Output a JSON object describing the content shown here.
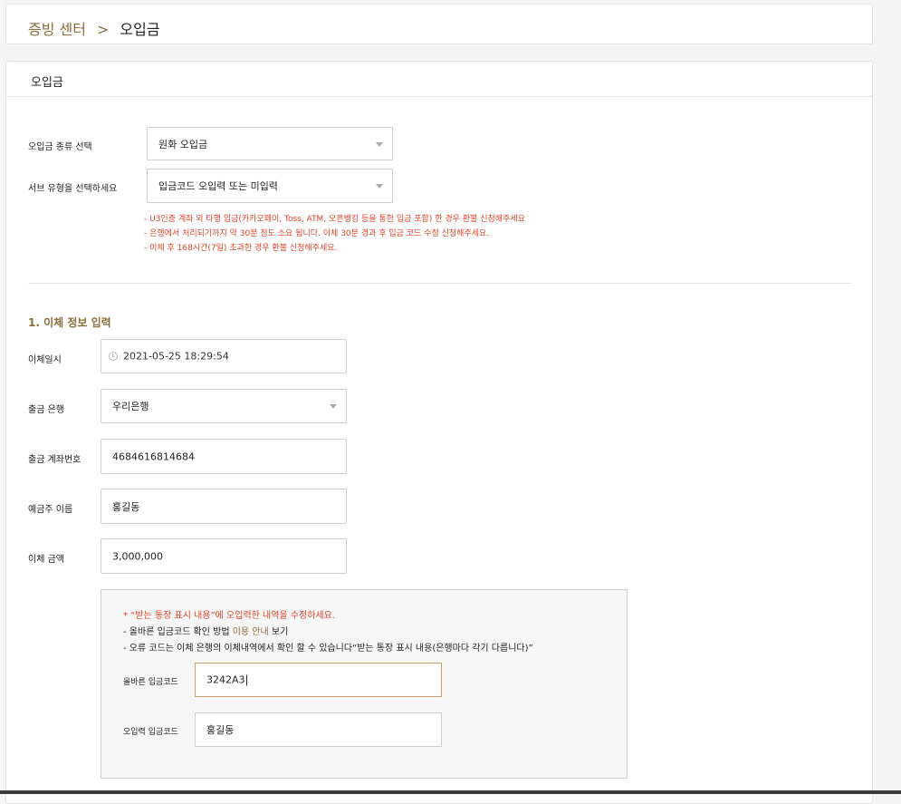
{
  "breadcrumb": {
    "parent": "증빙 센터",
    "separator": ">",
    "current": "오입금"
  },
  "panel": {
    "title": "오입금"
  },
  "form": {
    "type_label": "오입금 종류 선택",
    "type_value": "원화 오입금",
    "subtype_label": "서브 유형을 선택하세요",
    "subtype_value": "입금코드 오입력 또는 미입력",
    "notes": [
      "- U3인증 계좌 외 타행 입금(카카오페이, Toss, ATM, 오픈뱅킹 등을 통한 입금 포함) 한 경우 환불 신청해주세요",
      "- 은행에서 처리되기까지 약 30분 정도 소요 됩니다. 이체 30분 경과 후 입금 코드 수정 신청해주세요.",
      "- 이체 후 168시간(7일) 초과한 경우 환불 신청해주세요."
    ]
  },
  "section1": {
    "title": "1. 이체 정보 입력",
    "datetime_label": "이체일시",
    "datetime_value": "2021-05-25 18:29:54",
    "bank_label": "출금 은행",
    "bank_value": "우리은행",
    "account_label": "출금 계좌번호",
    "account_value": "4684616814684",
    "holder_label": "예금주 이름",
    "holder_value": "홍길동",
    "amount_label": "이체 금액",
    "amount_value": "3,000,000"
  },
  "info": {
    "line1": "* “받는 통장 표시 내용”에 오입력한 내역을 수정하세요.",
    "line2_pre": "- 올바른 입금코드 확인 방법 ",
    "line2_link": "이용 안내",
    "line2_post": " 보기",
    "line3": "- 오류 코드는 이체 은행의 이체내역에서 확인 할 수 있습니다“받는 통장 표시 내용(은행마다 각기 다릅니다)”",
    "correct_label": "올바른 입금코드",
    "correct_value": "3242A3",
    "wrong_label": "오입력 입금코드",
    "wrong_value": "홍길동"
  }
}
